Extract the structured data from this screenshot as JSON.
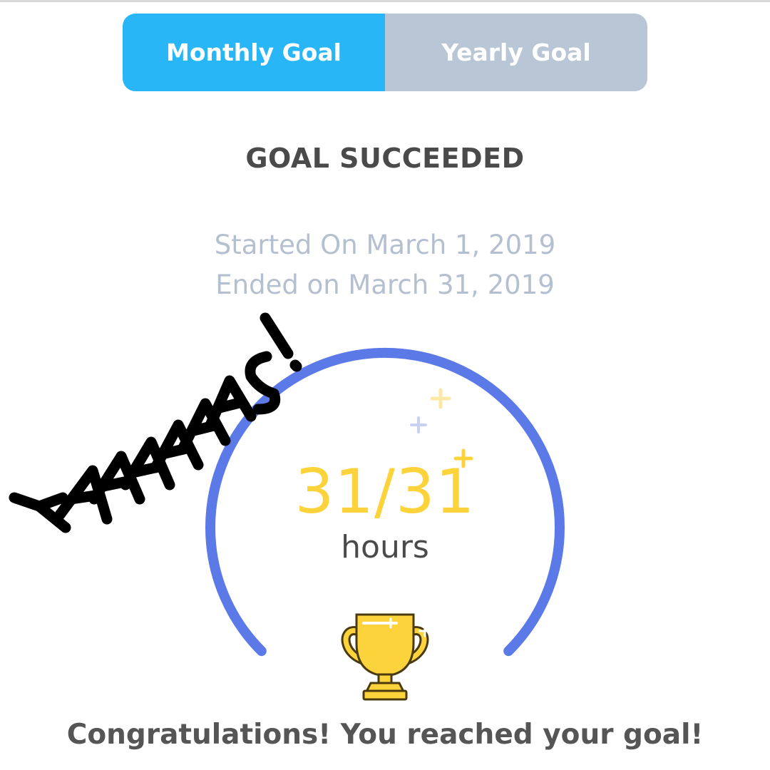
{
  "tabs": [
    {
      "label": "Monthly Goal",
      "active": true
    },
    {
      "label": "Yearly Goal",
      "active": false
    }
  ],
  "status": {
    "title": "GOAL SUCCEEDED",
    "started": "Started On March 1, 2019",
    "ended": "Ended on March 31, 2019"
  },
  "progress": {
    "count_text": "31/31",
    "current": 31,
    "target": 31,
    "fraction": 1.0,
    "unit": "hours"
  },
  "message": "Congratulations! You reached your goal!",
  "handwritten_annotation": "YAAAAAAS!",
  "icons": {
    "trophy": "trophy-icon",
    "sparkles": "sparkle-icon"
  },
  "colors": {
    "tab_active": "#29b6f6",
    "tab_inactive": "#b9c6d6",
    "ring": "#5b7ae8",
    "count": "#fdd33b",
    "trophy": "#fdd33b",
    "dates": "#b4c0cf"
  }
}
